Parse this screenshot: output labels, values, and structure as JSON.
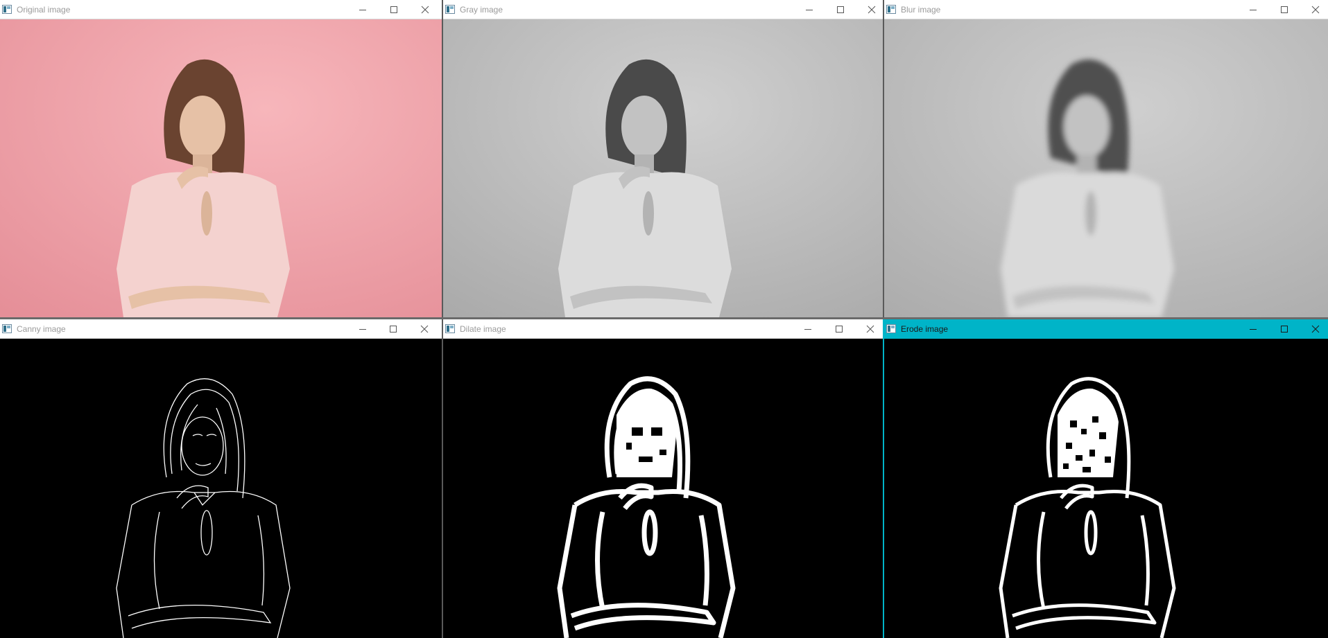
{
  "windows": [
    {
      "title": "Original image",
      "active": false,
      "style": "color"
    },
    {
      "title": "Gray image",
      "active": false,
      "style": "gray"
    },
    {
      "title": "Blur image",
      "active": false,
      "style": "blur"
    },
    {
      "title": "Canny image",
      "active": false,
      "style": "canny"
    },
    {
      "title": "Dilate image",
      "active": false,
      "style": "dilate"
    },
    {
      "title": "Erode image",
      "active": true,
      "style": "erode"
    }
  ],
  "colors": {
    "pink_background": "#f3a6ad",
    "gray_background": "#c4c4c4",
    "active_titlebar": "#00b4c8",
    "edge_white": "#ffffff",
    "edge_black": "#000000"
  },
  "icons": [
    "app-icon",
    "minimize-icon",
    "maximize-icon",
    "close-icon"
  ]
}
